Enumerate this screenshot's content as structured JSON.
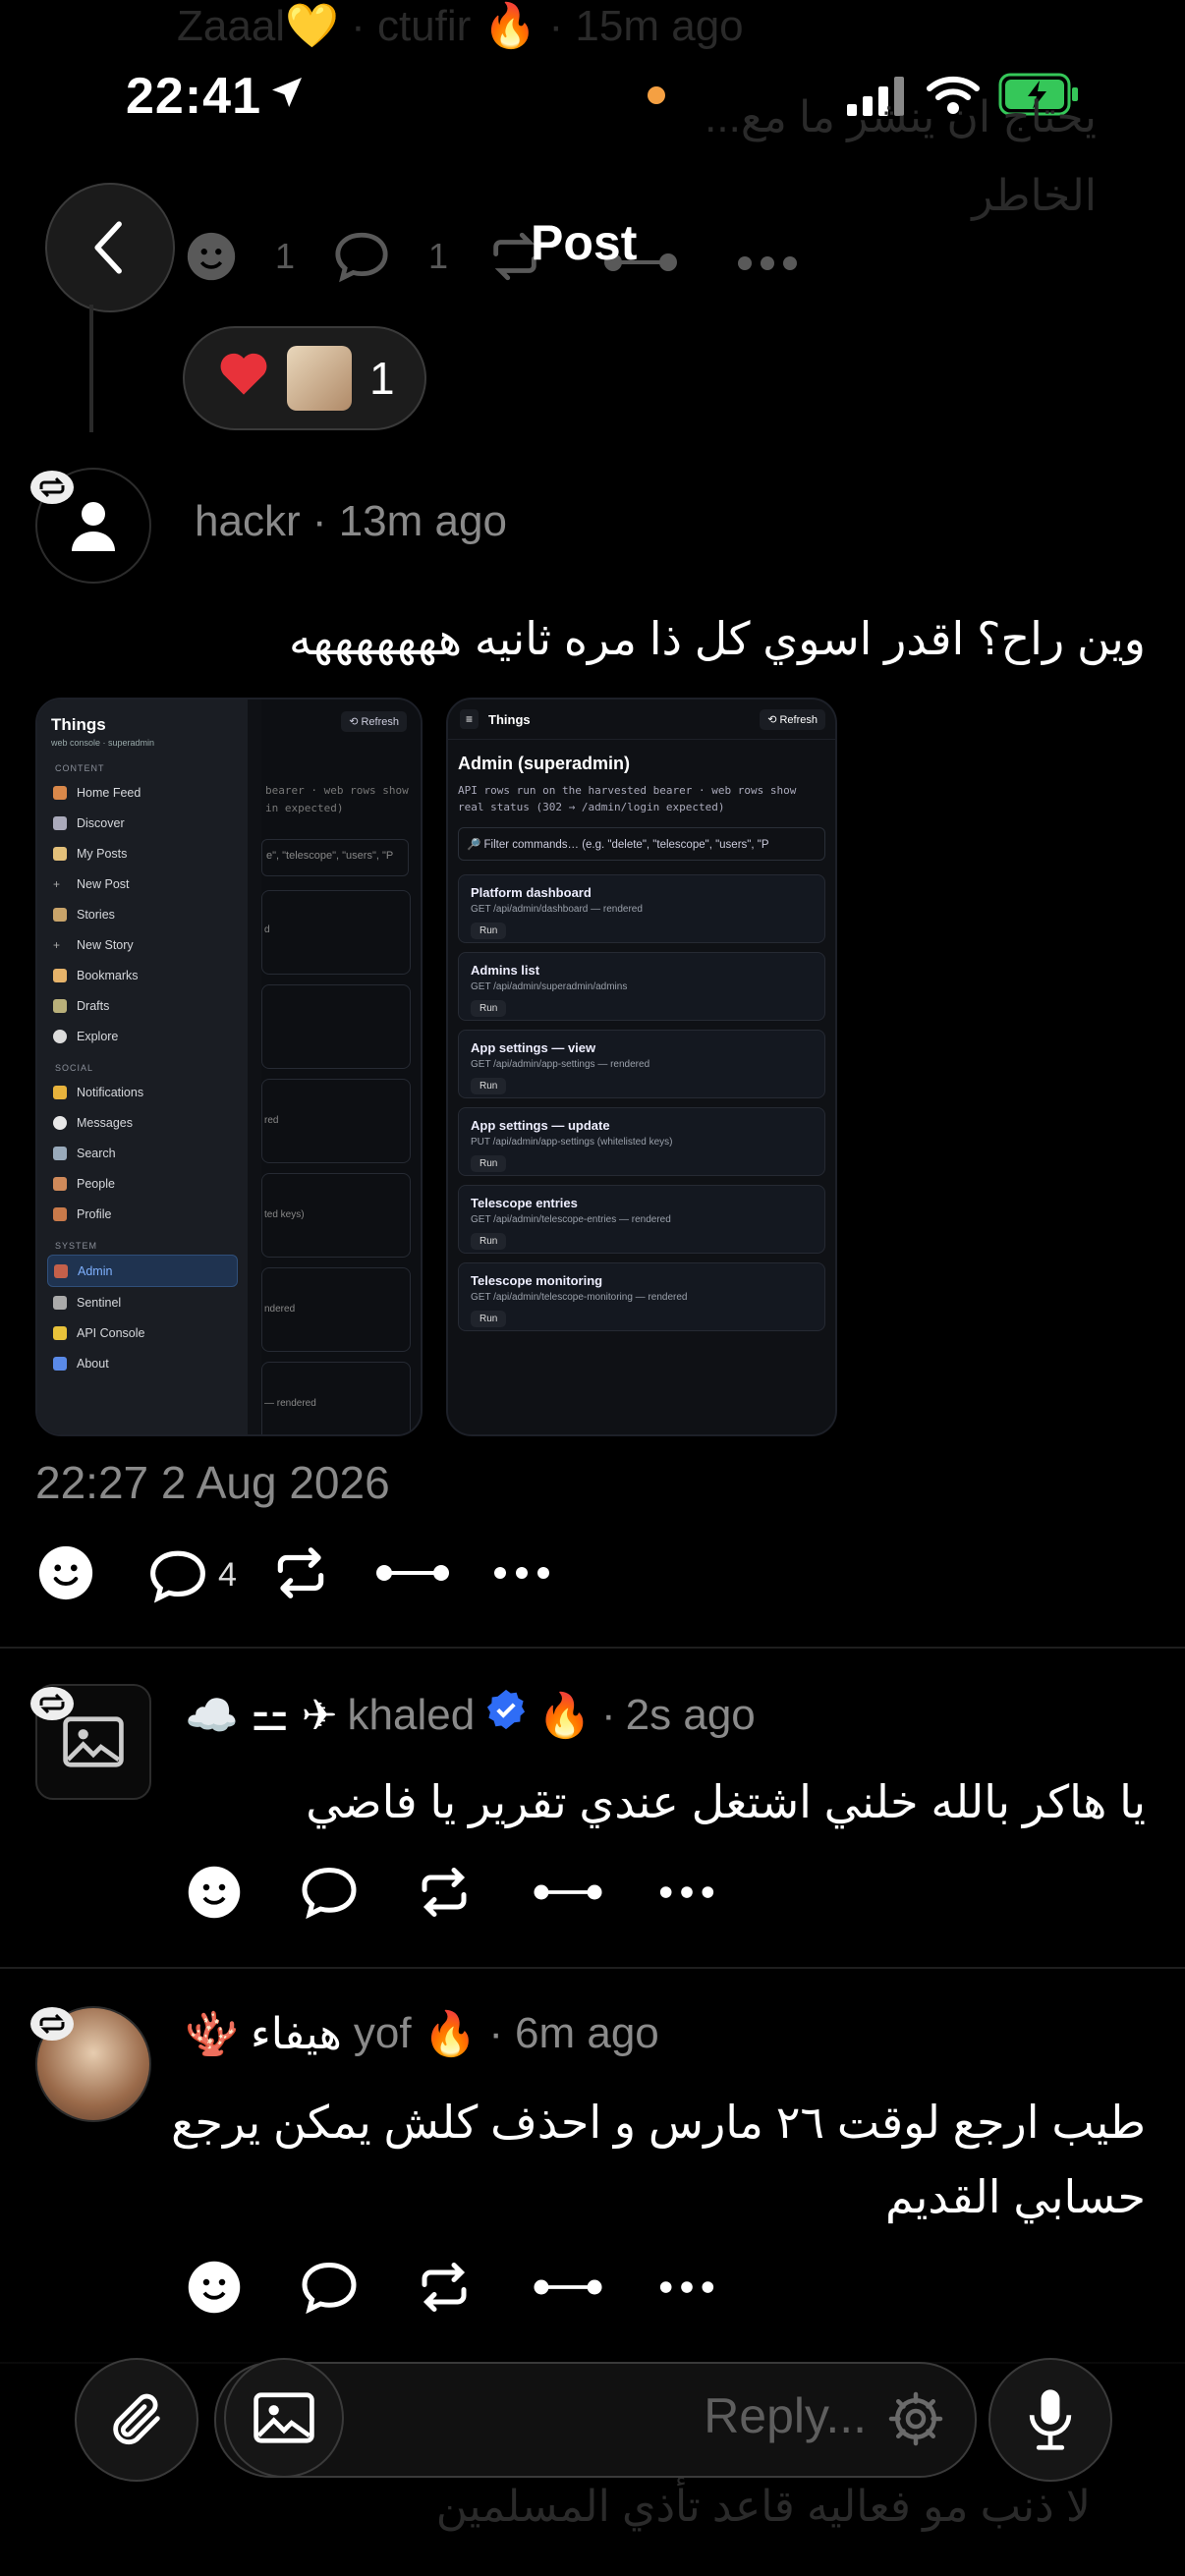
{
  "status_bar": {
    "time": "22:41"
  },
  "header": {
    "title": "Post",
    "back_label": "Back"
  },
  "ghost_top": {
    "line1": "يحتاج ان ينشر ما مع...",
    "line2": "الخاطر"
  },
  "parent_counts": {
    "comments": "1",
    "likes": "1"
  },
  "reaction": {
    "count": "1"
  },
  "main_post": {
    "author": "hackr",
    "time": "13m ago",
    "text": "وين راح؟ اقدر اسوي كل ذا مره ثانيه هههههههه",
    "timestamp": "22:27 2 Aug 2026",
    "comment_count": "4"
  },
  "shot_left": {
    "app": "Things",
    "subtitle": "web console · superadmin",
    "refresh": "⟲ Refresh",
    "sections": [
      {
        "title": "CONTENT",
        "items": [
          "Home Feed",
          "Discover",
          "My Posts",
          "New Post",
          "Stories",
          "New Story",
          "Bookmarks",
          "Drafts",
          "Explore"
        ]
      },
      {
        "title": "SOCIAL",
        "items": [
          "Notifications",
          "Messages",
          "Search",
          "People",
          "Profile"
        ]
      },
      {
        "title": "SYSTEM",
        "items": [
          "Admin",
          "Sentinel",
          "API Console",
          "About"
        ]
      }
    ],
    "active_item": "Admin",
    "bg_fragments": [
      "bearer · web rows show",
      "in expected)",
      "e\", \"telescope\", \"users\", \"P",
      "d",
      "red",
      "ted keys)",
      "ndered",
      "— rendered"
    ]
  },
  "shot_right": {
    "app": "Things",
    "refresh": "⟲ Refresh",
    "heading": "Admin (superadmin)",
    "desc": "API rows run on the harvested bearer · web rows show real status (302 → /admin/login expected)",
    "filter_placeholder": "🔎 Filter commands… (e.g. \"delete\", \"telescope\", \"users\", \"P",
    "commands": [
      {
        "title": "Platform dashboard",
        "sub": "GET /api/admin/dashboard — rendered",
        "run": "Run"
      },
      {
        "title": "Admins list",
        "sub": "GET /api/admin/superadmin/admins",
        "run": "Run"
      },
      {
        "title": "App settings — view",
        "sub": "GET /api/admin/app-settings — rendered",
        "run": "Run"
      },
      {
        "title": "App settings — update",
        "sub": "PUT /api/admin/app-settings (whitelisted keys)",
        "run": "Run"
      },
      {
        "title": "Telescope entries",
        "sub": "GET /api/admin/telescope-entries — rendered",
        "run": "Run"
      },
      {
        "title": "Telescope monitoring",
        "sub": "GET /api/admin/telescope-monitoring — rendered",
        "run": "Run"
      }
    ]
  },
  "replies": [
    {
      "name_prefix": "☁️ ⚍ ✈",
      "author": "khaled",
      "flame": "🔥",
      "time": "2s ago",
      "text": "يا هاكر بالله خلني اشتغل عندي تقرير يا فاضي"
    },
    {
      "name_prefix": "🪸 هيفاء",
      "author": "yof",
      "flame": "🔥",
      "time": "6m ago",
      "text": "طيب ارجع لوقت ٢٦ مارس و احذف كلش يمكن يرجع حسابي القديم"
    }
  ],
  "ghost_bottom": "لا ذنب مو فعاليه قاعد تأذي المسلمين",
  "reply_input": {
    "placeholder": "Reply..."
  },
  "colors": {
    "accent_blue": "#2f6df6",
    "heart": "#e8323a",
    "battery": "#35c759"
  }
}
